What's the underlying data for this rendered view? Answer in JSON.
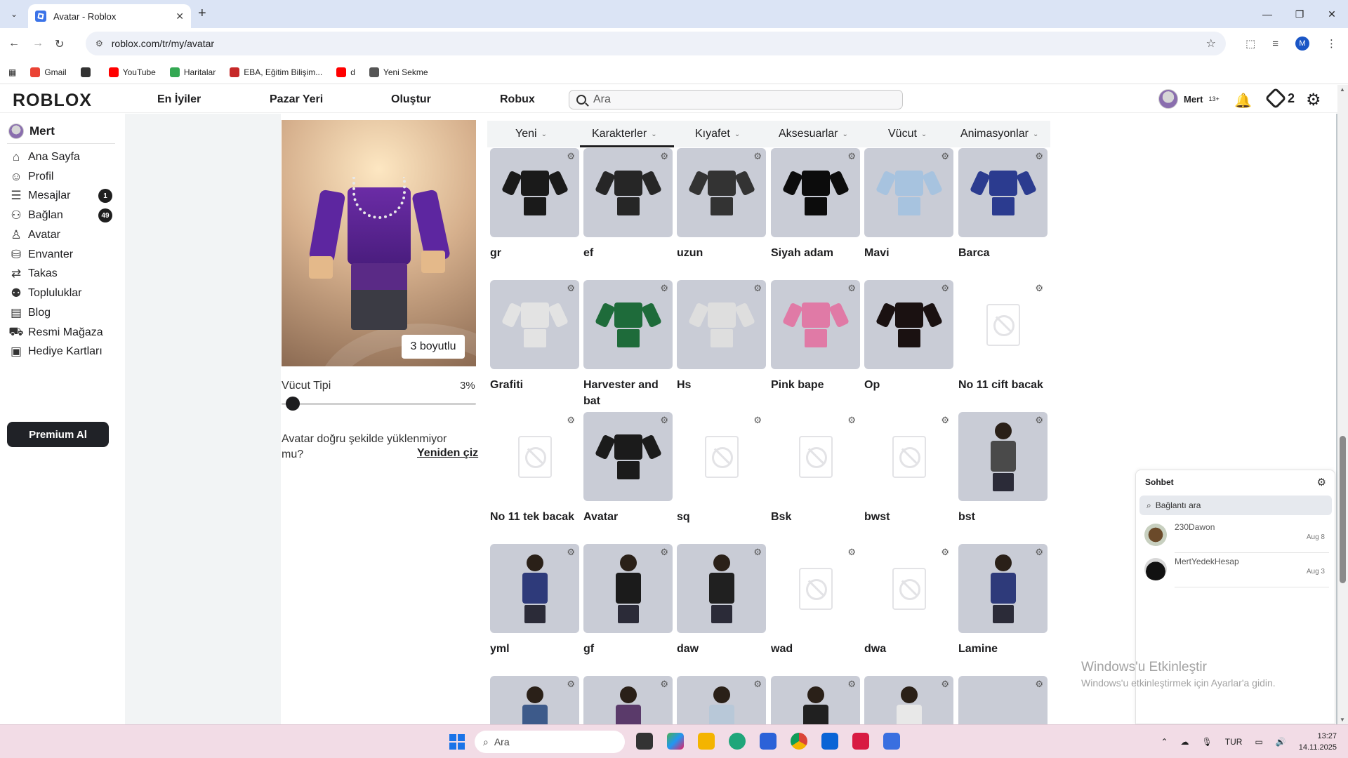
{
  "browser": {
    "tab_title": "Avatar - Roblox",
    "url": "roblox.com/tr/my/avatar",
    "bookmarks": [
      {
        "label": "Gmail",
        "color": "#ea4335"
      },
      {
        "label": "",
        "color": "#333333"
      },
      {
        "label": "YouTube",
        "color": "#ff0000"
      },
      {
        "label": "Haritalar",
        "color": "#34a853"
      },
      {
        "label": "EBA, Eğitim Bilişim...",
        "color": "#c62828"
      },
      {
        "label": "d",
        "color": "#ff0000"
      },
      {
        "label": "Yeni Sekme",
        "color": "#555555"
      }
    ],
    "profile_initial": "M"
  },
  "nav": {
    "logo": "ROBLOX",
    "links": [
      "En İyiler",
      "Pazar Yeri",
      "Oluştur",
      "Robux"
    ],
    "search_placeholder": "Ara",
    "username": "Mert",
    "age_label": "13+",
    "robux": "2"
  },
  "sidebar": {
    "username": "Mert",
    "items": [
      {
        "label": "Ana Sayfa",
        "icon": "home-icon",
        "badge": ""
      },
      {
        "label": "Profil",
        "icon": "profile-icon",
        "badge": ""
      },
      {
        "label": "Mesajlar",
        "icon": "messages-icon",
        "badge": "1"
      },
      {
        "label": "Bağlan",
        "icon": "friends-icon",
        "badge": "49"
      },
      {
        "label": "Avatar",
        "icon": "avatar-icon",
        "badge": ""
      },
      {
        "label": "Envanter",
        "icon": "inventory-icon",
        "badge": ""
      },
      {
        "label": "Takas",
        "icon": "trade-icon",
        "badge": ""
      },
      {
        "label": "Topluluklar",
        "icon": "groups-icon",
        "badge": ""
      },
      {
        "label": "Blog",
        "icon": "blog-icon",
        "badge": ""
      },
      {
        "label": "Resmi Mağaza",
        "icon": "store-icon",
        "badge": ""
      },
      {
        "label": "Hediye Kartları",
        "icon": "gift-card-icon",
        "badge": ""
      }
    ],
    "premium_label": "Premium Al"
  },
  "preview": {
    "view_toggle": "3 boyutlu",
    "body_type_label": "Vücut Tipi",
    "body_type_value": "3%",
    "body_type_fraction": 0.03,
    "redraw_question": "Avatar doğru şekilde yüklenmiyor mu?",
    "redraw_link": "Yeniden çiz"
  },
  "categories": {
    "tabs": [
      "Yeni",
      "Karakterler",
      "Kıyafet",
      "Aksesuarlar",
      "Vücut",
      "Animasyonlar"
    ],
    "active": "Karakterler"
  },
  "items": [
    {
      "name": "gr",
      "kind": "outfit",
      "color": "#1a1a1a"
    },
    {
      "name": "ef",
      "kind": "outfit",
      "color": "#262626"
    },
    {
      "name": "uzun",
      "kind": "outfit",
      "color": "#333333"
    },
    {
      "name": "Siyah adam",
      "kind": "outfit",
      "color": "#0c0c0c"
    },
    {
      "name": "Mavi",
      "kind": "outfit",
      "color": "#a7c3df"
    },
    {
      "name": "Barca",
      "kind": "outfit",
      "color": "#2b3b8f"
    },
    {
      "name": "Grafiti",
      "kind": "outfit",
      "color": "#e3e3e3"
    },
    {
      "name": "Harvester and bat",
      "kind": "outfit",
      "color": "#1e6b3a"
    },
    {
      "name": "Hs",
      "kind": "outfit",
      "color": "#dedede"
    },
    {
      "name": "Pink bape",
      "kind": "outfit",
      "color": "#e07aa6"
    },
    {
      "name": "Op",
      "kind": "outfit",
      "color": "#1a1111"
    },
    {
      "name": "No 11 cift bacak",
      "kind": "empty",
      "color": ""
    },
    {
      "name": "No 11 tek bacak",
      "kind": "empty",
      "color": ""
    },
    {
      "name": "Avatar",
      "kind": "outfit",
      "color": "#1b1b1b"
    },
    {
      "name": "sq",
      "kind": "empty",
      "color": ""
    },
    {
      "name": "Bsk",
      "kind": "empty",
      "color": ""
    },
    {
      "name": "bwst",
      "kind": "empty",
      "color": ""
    },
    {
      "name": "bst",
      "kind": "character",
      "color": "#4a4a4a"
    },
    {
      "name": "yml",
      "kind": "character",
      "color": "#2e3a7a"
    },
    {
      "name": "gf",
      "kind": "character",
      "color": "#1b1b1b"
    },
    {
      "name": "daw",
      "kind": "character",
      "color": "#202020"
    },
    {
      "name": "wad",
      "kind": "empty",
      "color": ""
    },
    {
      "name": "dwa",
      "kind": "empty",
      "color": ""
    },
    {
      "name": "Lamine",
      "kind": "character",
      "color": "#2e3a7a"
    },
    {
      "name": "",
      "kind": "character",
      "color": "#3d5a8a"
    },
    {
      "name": "",
      "kind": "character",
      "color": "#5a3a6a"
    },
    {
      "name": "",
      "kind": "character",
      "color": "#b8c8d8"
    },
    {
      "name": "",
      "kind": "character",
      "color": "#202020"
    },
    {
      "name": "",
      "kind": "character",
      "color": "#e8e8e8"
    },
    {
      "name": "",
      "kind": "blank",
      "color": ""
    }
  ],
  "chat": {
    "title": "Sohbet",
    "search_placeholder": "Bağlantı ara",
    "conversations": [
      {
        "name": "230Dawon",
        "date": "Aug 8"
      },
      {
        "name": "MertYedekHesap",
        "date": "Aug 3"
      }
    ]
  },
  "windows": {
    "activate_title": "Windows'u Etkinleştir",
    "activate_sub": "Windows'u etkinleştirmek için Ayarlar'a gidin.",
    "taskbar_search": "Ara",
    "language": "TUR",
    "time": "13:27",
    "date": "14.11.2025"
  }
}
